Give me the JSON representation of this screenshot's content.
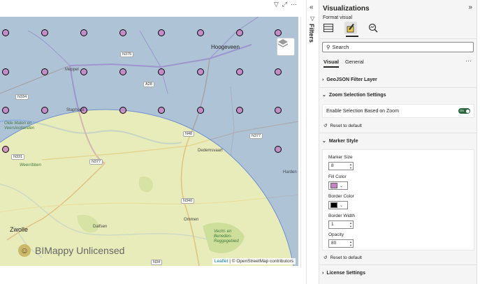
{
  "map": {
    "attribution_leaflet": "Leaflet",
    "attribution_rest": " | © OpenStreetMap contributors",
    "watermark": "BIMappy Unlicensed",
    "labels": {
      "hoogeveen": "Hoogeveen",
      "meppel": "Meppel",
      "staphorst": "Staphorst",
      "dedemsvaart": "Dedemsvaart",
      "zwolle": "Zwolle",
      "dalfsen": "Dalfsen",
      "ommen": "Ommen",
      "vecht": "Vecht- en Beneden- Reggegebied",
      "olde_maten": "Olde Maten en Veerslootlanden",
      "weerribben": "Weerribben",
      "hardenberg": "Harden"
    },
    "roads": {
      "n375": "N375",
      "a28": "A28",
      "n334": "N334",
      "n377a": "N377",
      "n377b": "N377",
      "n48": "N48",
      "n331": "N331",
      "n340": "N340",
      "n34": "N34"
    },
    "icons": {
      "layers": "layers-icon",
      "filter": "filter-icon",
      "focus": "focus-mode-icon",
      "more": "more-options-icon"
    },
    "colors": {
      "blue_selection": "#7f9fd9",
      "green_area": "#dde8a8",
      "marker_fill": "#c07ac0",
      "marker_border": "#000000"
    }
  },
  "filters": {
    "collapse": "«",
    "label": "Filters"
  },
  "viz": {
    "title": "Visualizations",
    "expand": "»",
    "subtitle": "Format visual",
    "tabs": [
      "build-visual",
      "format-visual",
      "analytics"
    ],
    "search_placeholder": "Search",
    "sub_tabs": [
      "Visual",
      "General"
    ],
    "sub_more": "···",
    "sections": {
      "geojson": "GeoJSON Filter Layer",
      "zoom": "Zoom Selection Settings",
      "marker": "Marker Style",
      "license": "License Settings"
    },
    "zoom_toggle_label": "Enable Selection Based on Zoom",
    "toggle_text": "On",
    "reset": "Reset to default",
    "marker": {
      "size_label": "Marker Size",
      "size_value": "8",
      "fill_label": "Fill Color",
      "fill_color": "#c980c6",
      "border_label": "Border Color",
      "border_color": "#000000",
      "width_label": "Border Width",
      "width_value": "1",
      "opacity_label": "Opacity",
      "opacity_value": "80"
    }
  }
}
